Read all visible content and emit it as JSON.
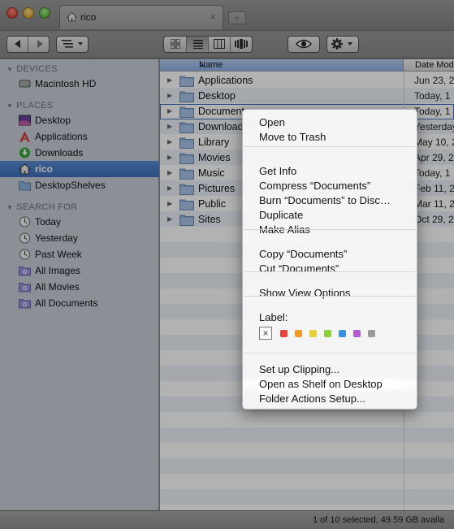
{
  "window": {
    "tab_title": "rico",
    "tab_close": "×",
    "new_tab": "+"
  },
  "toolbar": {
    "back_icon": "back-arrow-icon",
    "forward_icon": "forward-arrow-icon",
    "arrange_icon": "arrange-menu-icon",
    "view_modes": [
      "icon-view-icon",
      "list-view-icon",
      "column-view-icon",
      "coverflow-view-icon"
    ],
    "active_view": "list-view-icon",
    "quicklook_icon": "eye-icon",
    "action_icon": "gear-icon"
  },
  "sidebar": {
    "sections": [
      {
        "heading": "DEVICES",
        "items": [
          {
            "label": "Macintosh HD",
            "icon": "hard-drive-icon"
          }
        ]
      },
      {
        "heading": "PLACES",
        "items": [
          {
            "label": "Desktop",
            "icon": "desktop-icon"
          },
          {
            "label": "Applications",
            "icon": "applications-icon"
          },
          {
            "label": "Downloads",
            "icon": "downloads-icon"
          },
          {
            "label": "rico",
            "icon": "home-icon",
            "selected": true
          },
          {
            "label": "DesktopShelves",
            "icon": "folder-icon"
          }
        ]
      },
      {
        "heading": "SEARCH FOR",
        "items": [
          {
            "label": "Today",
            "icon": "clock-icon"
          },
          {
            "label": "Yesterday",
            "icon": "clock-icon"
          },
          {
            "label": "Past Week",
            "icon": "clock-icon"
          },
          {
            "label": "All Images",
            "icon": "smart-folder-icon"
          },
          {
            "label": "All Movies",
            "icon": "smart-folder-icon"
          },
          {
            "label": "All Documents",
            "icon": "smart-folder-icon"
          }
        ]
      }
    ]
  },
  "list": {
    "columns": {
      "name": "Name",
      "date": "Date Mod"
    },
    "rows": [
      {
        "name": "Applications",
        "date": "Jun 23, 2"
      },
      {
        "name": "Desktop",
        "date": "Today, 1"
      },
      {
        "name": "Documents",
        "date": "Today, 1"
      },
      {
        "name": "Downloads",
        "date": "Yesterday"
      },
      {
        "name": "Library",
        "date": "May 10, 2"
      },
      {
        "name": "Movies",
        "date": "Apr 29, 2"
      },
      {
        "name": "Music",
        "date": "Today, 1"
      },
      {
        "name": "Pictures",
        "date": "Feb 11, 2"
      },
      {
        "name": "Public",
        "date": "Mar 11, 2"
      },
      {
        "name": "Sites",
        "date": "Oct 29, 2"
      }
    ],
    "focused_index": 2
  },
  "context_menu": {
    "groups": [
      [
        "Open",
        "Move to Trash"
      ],
      [
        "Get Info",
        "Compress “Documents”",
        "Burn “Documents” to Disc…",
        "Duplicate",
        "Make Alias"
      ],
      [
        "Copy “Documents”",
        "Cut “Documents”"
      ],
      [
        "Show View Options"
      ],
      [
        "Set up Clipping...",
        "Open as Shelf on Desktop",
        "Folder Actions Setup..."
      ]
    ],
    "label_heading": "Label:",
    "label_none": "×",
    "label_colors": [
      "#e8443a",
      "#f39a2b",
      "#e6d03a",
      "#8ccf3b",
      "#3b8fe0",
      "#b45bd1",
      "#9a9a9a"
    ],
    "highlighted_item": "Open as Shelf on Desktop"
  },
  "status": {
    "text": "1 of 10 selected, 49.59 GB availa"
  }
}
